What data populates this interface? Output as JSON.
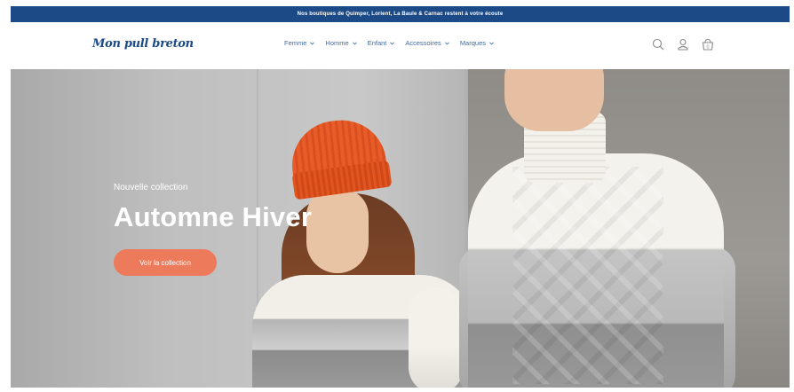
{
  "announcement": "Nos boutiques de Quimper, Lorient, La Baule & Carnac restent à votre écoute",
  "brand": {
    "name": "Mon pull breton"
  },
  "nav": [
    {
      "label": "Femme"
    },
    {
      "label": "Homme"
    },
    {
      "label": "Enfant"
    },
    {
      "label": "Accessoires"
    },
    {
      "label": "Marques"
    }
  ],
  "header_icons": [
    "search-icon",
    "account-icon",
    "cart-icon"
  ],
  "cart": {
    "count": "0"
  },
  "hero": {
    "eyebrow": "Nouvelle collection",
    "title": "Automne Hiver",
    "cta_label": "Voir la collection"
  },
  "colors": {
    "announcement_bg": "#1b4a86",
    "brand_text": "#1b4a86",
    "nav_text": "#3d6aa5",
    "cta_bg": "#ec7a5b"
  }
}
